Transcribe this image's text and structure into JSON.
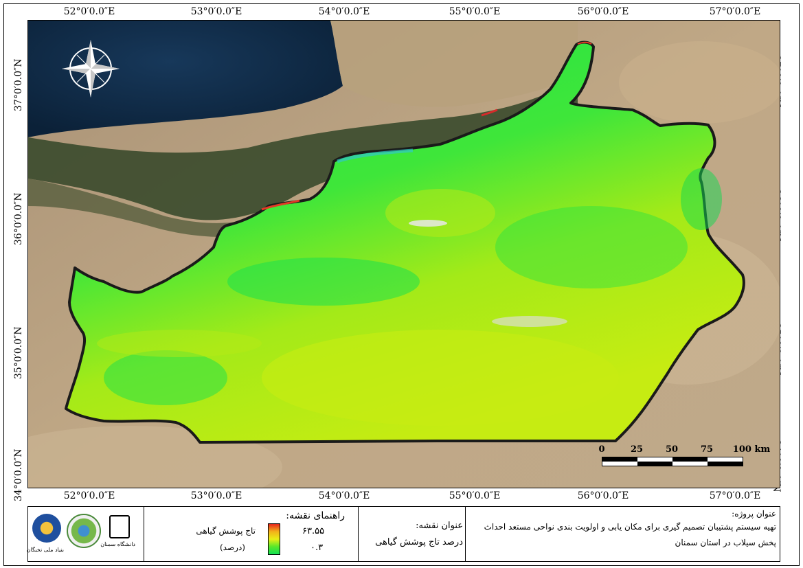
{
  "map": {
    "top_lon_labels": [
      "52°0′0.0″E",
      "53°0′0.0″E",
      "54°0′0.0″E",
      "55°0′0.0″E",
      "56°0′0.0″E",
      "57°0′0.0″E"
    ],
    "bottom_lon_labels": [
      "52°0′0.0″E",
      "53°0′0.0″E",
      "54°0′0.0″E",
      "55°0′0.0″E",
      "56°0′0.0″E",
      "57°0′0.0″E"
    ],
    "left_lat_labels": [
      "37°0′0.0″N",
      "36°0′0.0″N",
      "35°0′0.0″N",
      "34°0′0.0″N"
    ],
    "right_lat_labels": [
      "37°0′0.0″N",
      "36°0′0.0″N",
      "35°0′0.0″N",
      "34°0′0.0″N"
    ],
    "scale_labels": [
      "0",
      "25",
      "50",
      "75",
      "100 km"
    ],
    "north_arrow_icon": "compass-rose-icon",
    "colors": {
      "sea": "#0f2a44",
      "desert": "#b79f7e",
      "forest": "#3c4c2e",
      "veg_high": "#19e34a",
      "veg_low": "#c2ec12",
      "boundary": "#1a1a1a"
    }
  },
  "footer": {
    "logos": [
      {
        "name": "nokhbegan-logo",
        "caption": "بنیاد ملی نخبگان"
      },
      {
        "name": "watershed-logo",
        "caption": ""
      },
      {
        "name": "semnan-university-logo",
        "caption": "دانشگاه سمنان"
      }
    ],
    "legend_title": "راهنمای نقشه:",
    "legend_layer": "تاج پوشش گیاهی",
    "legend_unit": "(درصد)",
    "legend_max": "۶۳.۵۵",
    "legend_min": "۰.۳",
    "legend_colors": [
      "#e8261c",
      "#f2b21a",
      "#e9ee16",
      "#57e82a",
      "#12e054"
    ],
    "map_title_label": "عنوان نقشه:",
    "map_title": "درصد تاج پوشش گیاهی",
    "project_title_label": "عنوان پروژه:",
    "project_title_line1": "تهیه سیستم پشتیبان تصمیم گیری برای مکان یابی و اولویت بندی نواحی مستعد احداث",
    "project_title_line2": "پخش سیلاب در استان سمنان"
  }
}
